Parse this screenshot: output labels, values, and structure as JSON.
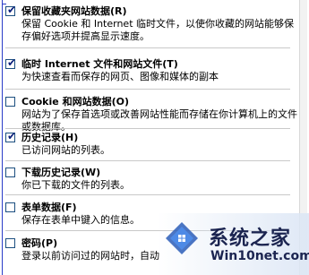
{
  "options": [
    {
      "checked": true,
      "title": "保留收藏夹网站数据(R)",
      "desc": "保留 Cookie 和 Internet 临时文件，以使你收藏的网站能够保存偏好选项并提高显示速度。"
    },
    {
      "checked": true,
      "title": "临时 Internet 文件和网站文件(T)",
      "desc": "为快速查看而保存的网页、图像和媒体的副本"
    },
    {
      "checked": false,
      "title": "Cookie 和网站数据(O)",
      "desc": "网站为了保存首选项或改善网站性能而存储在你计算机上的文件或数据库。"
    },
    {
      "checked": true,
      "title": "历史记录(H)",
      "desc": "已访问网站的列表。"
    },
    {
      "checked": false,
      "title": "下载历史记录(W)",
      "desc": "你已下载的文件的列表。"
    },
    {
      "checked": false,
      "title": "表单数据(F)",
      "desc": "保存在表单中键入的信息。"
    },
    {
      "checked": false,
      "title": "密码(P)",
      "desc": "登录以前访问过的网站时，自动"
    }
  ],
  "watermark": {
    "text": "系统之家",
    "url": "Win10net.com",
    "icon": "windows-logo-icon"
  }
}
